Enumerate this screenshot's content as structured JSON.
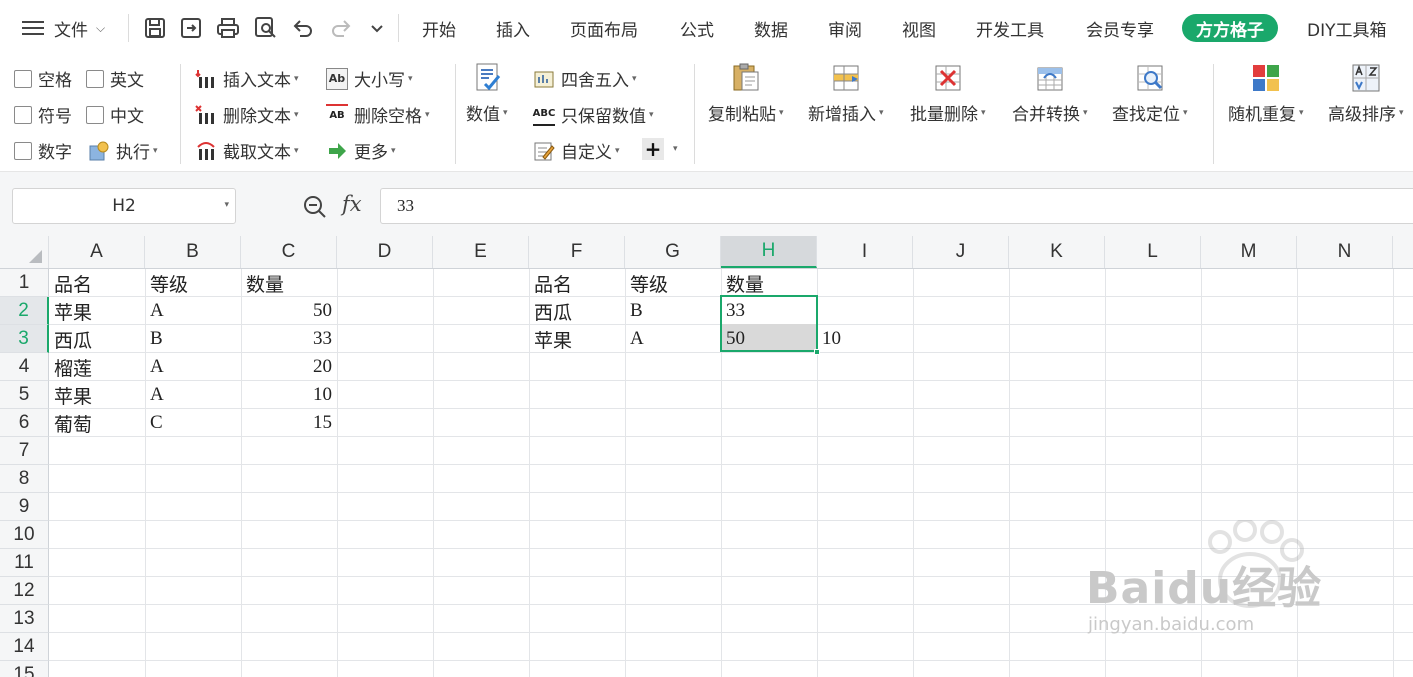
{
  "menubar": {
    "file_label": "文件",
    "tabs": [
      {
        "label": "开始"
      },
      {
        "label": "插入"
      },
      {
        "label": "页面布局"
      },
      {
        "label": "公式"
      },
      {
        "label": "数据"
      },
      {
        "label": "审阅"
      },
      {
        "label": "视图"
      },
      {
        "label": "开发工具"
      },
      {
        "label": "会员专享"
      },
      {
        "label": "方方格子",
        "active": true
      },
      {
        "label": "DIY工具箱"
      }
    ],
    "accent_color": "#1aa86b"
  },
  "ribbon": {
    "checkboxes": {
      "space": "空格",
      "english": "英文",
      "symbol": "符号",
      "chinese": "中文",
      "number": "数字"
    },
    "execute": "执行",
    "text_ops": {
      "insert": "插入文本",
      "delete": "删除文本",
      "cut": "截取文本"
    },
    "case_ops": {
      "case": "大小写",
      "remove_space": "删除空格",
      "more": "更多"
    },
    "value": "数值",
    "rounding": {
      "round": "四舍五入",
      "keep_value": "只保留数值",
      "custom": "自定义"
    },
    "big_buttons": {
      "copy_paste": "复制粘贴",
      "insert_new": "新增插入",
      "batch_delete": "批量删除",
      "merge_convert": "合并转换",
      "find_locate": "查找定位",
      "random_repeat": "随机重复",
      "advanced_sort": "高级排序"
    },
    "icons": {
      "case": "Ab",
      "remove_space": "AB",
      "abc": "ABC",
      "plus": "+"
    }
  },
  "formula_bar": {
    "name_box": "H2",
    "fx": "fx",
    "value": "33"
  },
  "grid": {
    "columns": [
      "A",
      "B",
      "C",
      "D",
      "E",
      "F",
      "G",
      "H",
      "I",
      "J",
      "K",
      "L",
      "M",
      "N"
    ],
    "selected_column": "H",
    "rows": [
      "1",
      "2",
      "3",
      "4",
      "5",
      "6",
      "7",
      "8",
      "9",
      "10",
      "11",
      "12",
      "13",
      "14",
      "15"
    ],
    "selected_rows": [
      "2",
      "3"
    ],
    "table1": {
      "headers": [
        "品名",
        "等级",
        "数量"
      ],
      "rows": [
        [
          "苹果",
          "A",
          "50"
        ],
        [
          "西瓜",
          "B",
          "33"
        ],
        [
          "榴莲",
          "A",
          "20"
        ],
        [
          "苹果",
          "A",
          "10"
        ],
        [
          "葡萄",
          "C",
          "15"
        ]
      ]
    },
    "table2": {
      "headers": [
        "品名",
        "等级",
        "数量"
      ],
      "rows": [
        [
          "西瓜",
          "B",
          "33"
        ],
        [
          "苹果",
          "A",
          "50"
        ]
      ]
    },
    "i3": "10"
  },
  "watermark": {
    "brand": "Baidu经验",
    "url": "jingyan.baidu.com"
  }
}
